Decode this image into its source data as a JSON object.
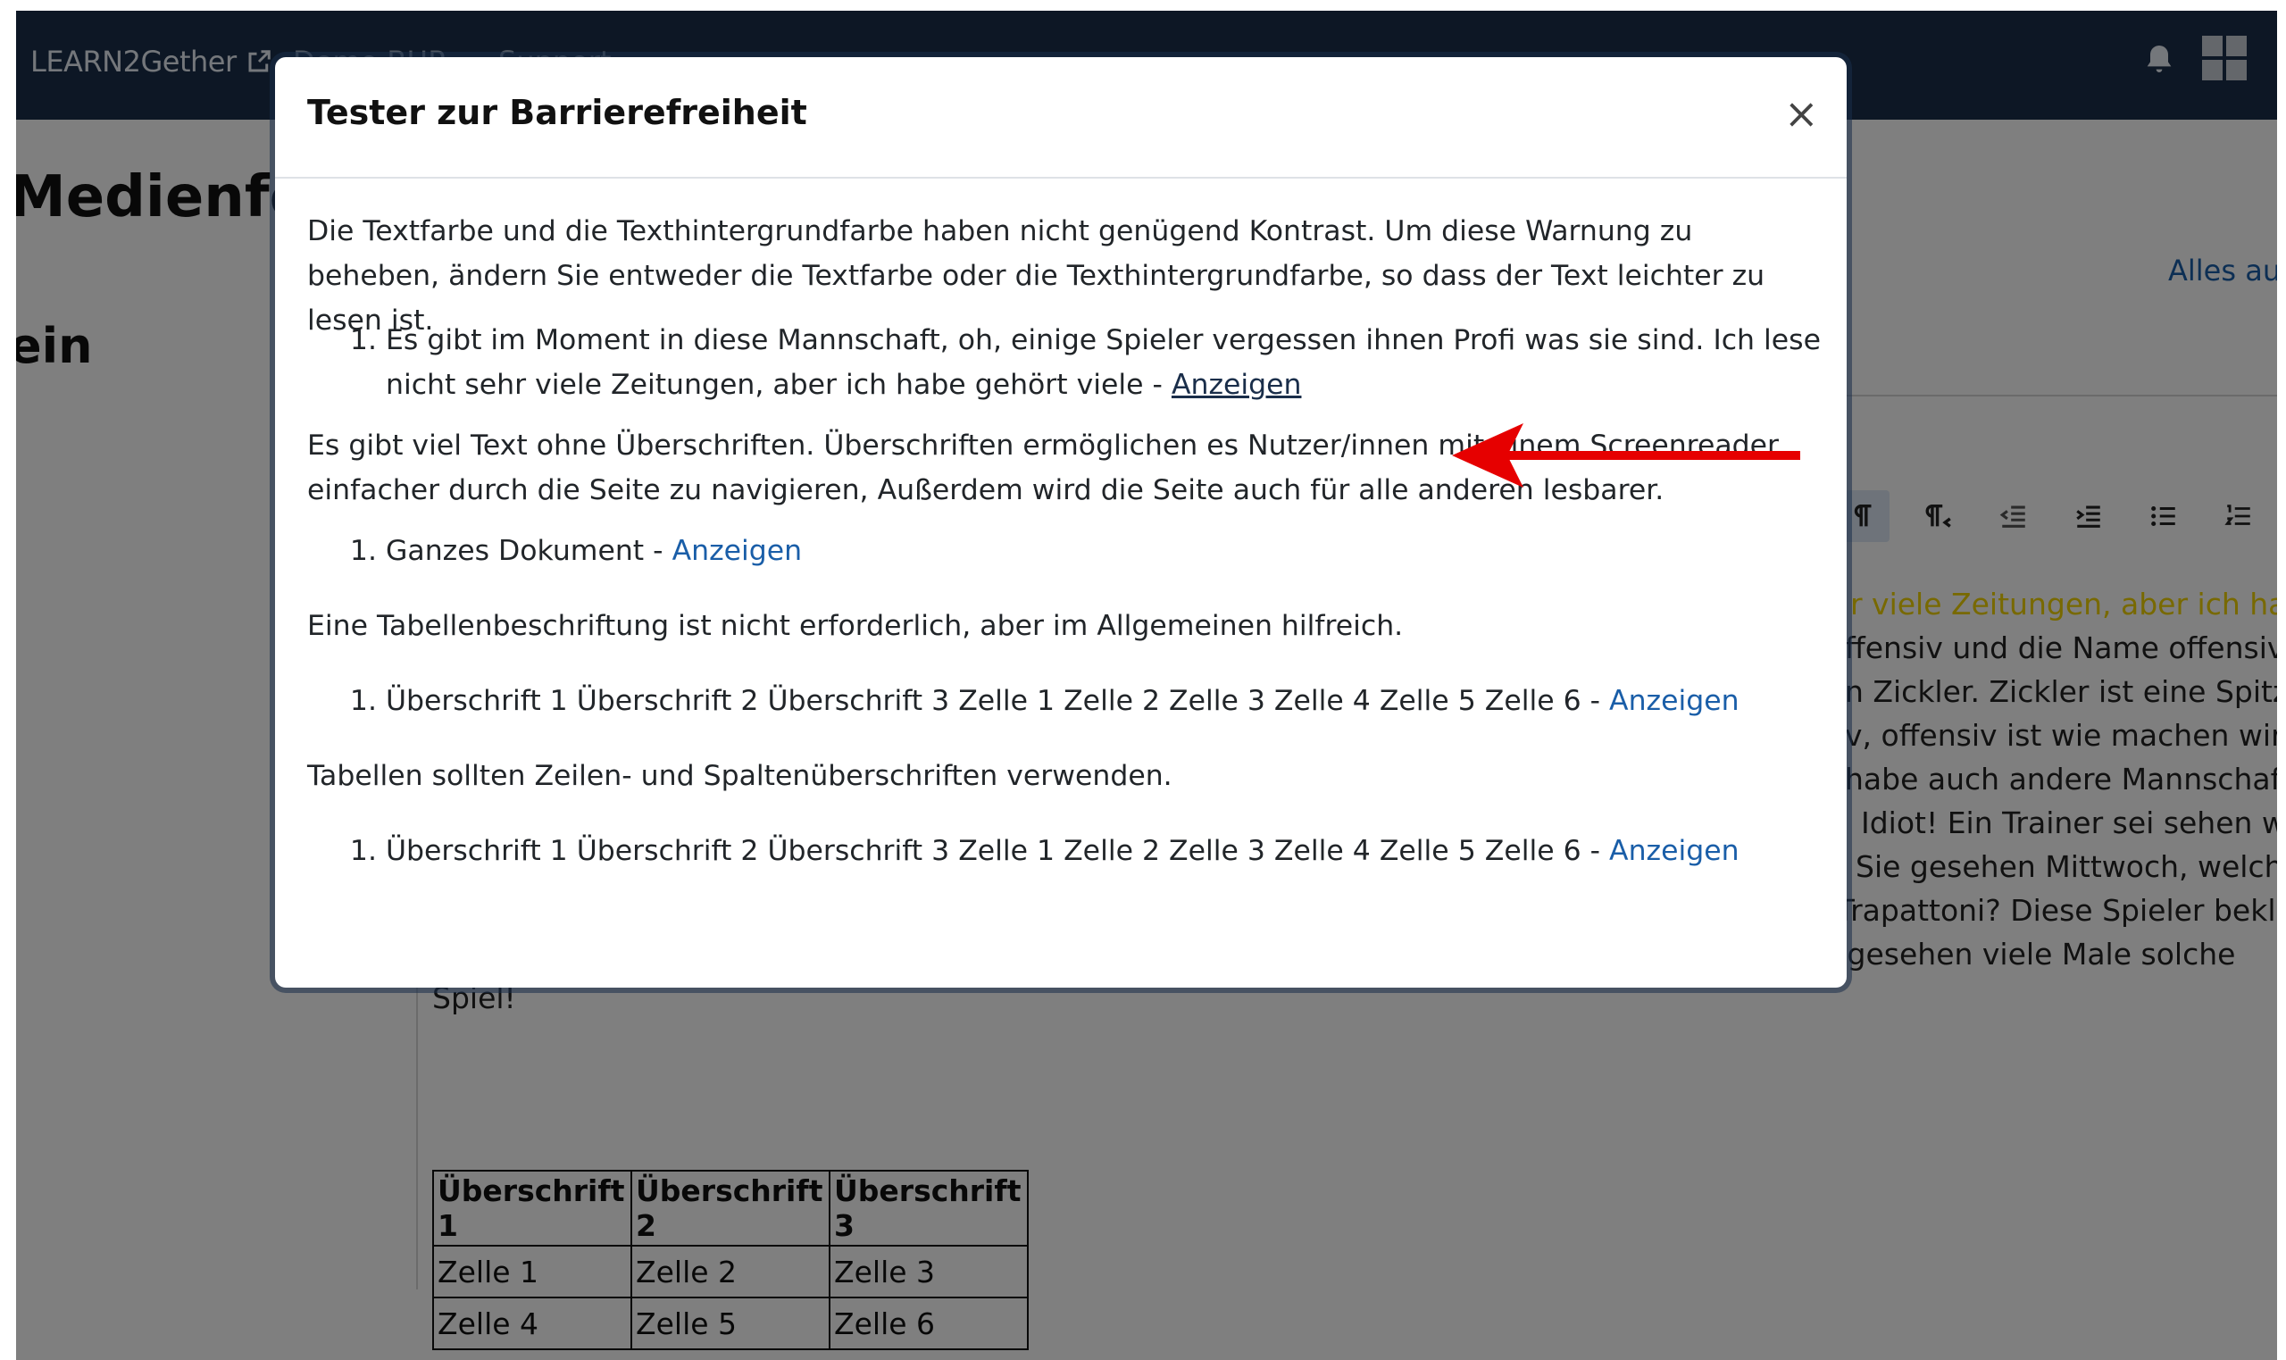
{
  "topbar": {
    "brand": "LEARN2Gether",
    "nav_links": [
      "Demo BHP",
      "Support"
    ]
  },
  "page": {
    "title": "Medienfe",
    "subtitle": "ein",
    "collapse_all": "Alles auf"
  },
  "editor": {
    "lines": [
      [
        "r viele Zeitungen, aber ich habe",
        true
      ],
      [
        "ffensiv und die Name offensiv wie",
        false
      ],
      [
        "n Zickler. Zickler ist eine Spitzen",
        false
      ],
      [
        "v, offensiv ist wie machen wir in",
        false
      ],
      [
        "habe auch andere Mannschaften",
        false
      ],
      [
        "Idiot! Ein Trainer sei sehen was",
        false
      ],
      [
        "Sie gesehen Mittwoch, welche",
        false
      ],
      [
        "Mannschaft hat gespielt Mittwoch? Hat gespielt Mehmet oder gespielt Basler oder hat gespielt Trapattoni? Diese Spieler beklagen mehr als sie",
        false
      ],
      [
        "spielen! Wissen Sie, warum die Italienmannschaften kaufen nicht diese Spieler? Weil wir haben gesehen viele Male solche",
        false
      ],
      [
        "Spiel!",
        false
      ]
    ],
    "table": {
      "headers": [
        "Überschrift 1",
        "Überschrift 2",
        "Überschrift 3"
      ],
      "rows": [
        [
          "Zelle 1",
          "Zelle 2",
          "Zelle 3"
        ],
        [
          "Zelle 4",
          "Zelle 5",
          "Zelle 6"
        ]
      ]
    }
  },
  "modal": {
    "title": "Tester zur Barrierefreiheit",
    "close": "×",
    "issues": [
      {
        "text": "Die Textfarbe und die Texthintergrundfarbe haben nicht genügend Kontrast. Um diese Warnung zu beheben, ändern Sie entweder die Textfarbe oder die Texthintergrundfarbe, so dass der Text leichter zu lesen ist.",
        "item": "Es gibt im Moment in diese Mannschaft, oh, einige Spieler vergessen ihnen Profi was sie sind. Ich lese nicht sehr viele Zeitungen, aber ich habe gehört viele - ",
        "link": "Anzeigen"
      },
      {
        "text": "Es gibt viel Text ohne Überschriften. Überschriften ermöglichen es Nutzer/innen mit einem Screenreader, einfacher durch die Seite zu navigieren, Außerdem wird die Seite auch für alle anderen lesbarer.",
        "item": "Ganzes Dokument - ",
        "link": "Anzeigen"
      },
      {
        "text": "Eine Tabellenbeschriftung ist nicht erforderlich, aber im Allgemeinen hilfreich.",
        "item": "Überschrift 1 Überschrift 2 Überschrift 3 Zelle 1 Zelle 2 Zelle 3 Zelle 4 Zelle 5 Zelle 6 - ",
        "link": "Anzeigen"
      },
      {
        "text": "Tabellen sollten Zeilen- und Spaltenüberschriften verwenden.",
        "item": "Überschrift 1 Überschrift 2 Überschrift 3 Zelle 1 Zelle 2 Zelle 3 Zelle 4 Zelle 5 Zelle 6 - ",
        "link": "Anzeigen"
      }
    ]
  },
  "colors": {
    "topbar": "#1a2e4a",
    "link": "#1a5ea8",
    "annotation_arrow": "#e60000",
    "highlight_text": "#f0d200"
  }
}
